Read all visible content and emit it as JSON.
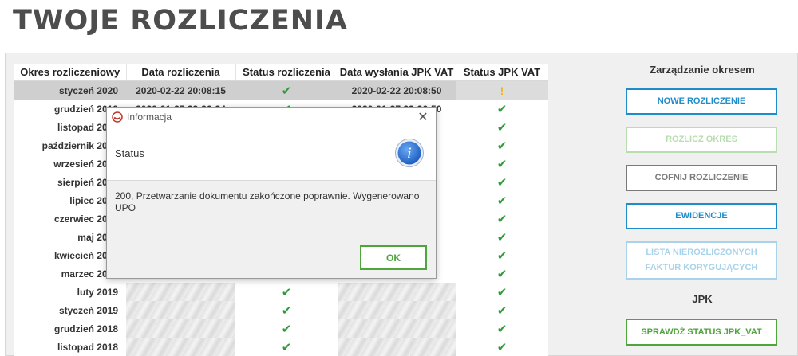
{
  "page": {
    "title": "TWOJE ROZLICZENIA"
  },
  "table": {
    "headers": [
      "Okres rozliczeniowy",
      "Data rozliczenia",
      "Status rozliczenia",
      "Data wysłania JPK VAT",
      "Status JPK VAT"
    ],
    "rows": [
      {
        "period": "styczeń 2020",
        "date": "2020-02-22 20:08:15",
        "sent": "2020-02-22 20:08:50",
        "jpk_status": "warning"
      },
      {
        "period": "grudzień 2019",
        "date": "2020-01-27 22:26:24",
        "sent": "2020-01-27 22:26:50",
        "jpk_status": "ok"
      },
      {
        "period": "listopad 2019",
        "date": "",
        "sent": "",
        "jpk_status": "ok"
      },
      {
        "period": "październik 2019",
        "date": "",
        "sent": "",
        "jpk_status": "ok"
      },
      {
        "period": "wrzesień 2019",
        "date": "",
        "sent": "",
        "jpk_status": "ok"
      },
      {
        "period": "sierpień 2019",
        "date": "",
        "sent": "",
        "jpk_status": "ok"
      },
      {
        "period": "lipiec 2019",
        "date": "",
        "sent": "",
        "jpk_status": "ok"
      },
      {
        "period": "czerwiec 2019",
        "date": "",
        "sent": "",
        "jpk_status": "ok"
      },
      {
        "period": "maj 2019",
        "date": "",
        "sent": "",
        "jpk_status": "ok"
      },
      {
        "period": "kwiecień 2019",
        "date": "",
        "sent": "",
        "jpk_status": "ok"
      },
      {
        "period": "marzec 2019",
        "date": "",
        "sent": "",
        "jpk_status": "ok"
      },
      {
        "period": "luty 2019",
        "date": "",
        "sent": "",
        "jpk_status": "ok"
      },
      {
        "period": "styczeń 2019",
        "date": "",
        "sent": "",
        "jpk_status": "ok"
      },
      {
        "period": "grudzień 2018",
        "date": "",
        "sent": "",
        "jpk_status": "ok"
      },
      {
        "period": "listopad 2018",
        "date": "",
        "sent": "",
        "jpk_status": "ok"
      }
    ],
    "icons": {
      "ok": "✔",
      "warning": "!"
    },
    "colors": {
      "ok": "#2e9a3a",
      "warning": "#f2b705"
    }
  },
  "sidebar": {
    "heading": "Zarządzanie okresem",
    "new_label": "NOWE ROZLICZENIE",
    "settle_label": "ROZLICZ OKRES",
    "undo_label": "COFNIJ ROZLICZENIE",
    "records_label": "EWIDENCJE",
    "list_label_line1": "LISTA NIEROZLICZONYCH",
    "list_label_line2": "FAKTUR KORYGUJĄCYCH",
    "jpk_heading": "JPK",
    "check_status_label": "SPRAWDŹ STATUS JPK_VAT"
  },
  "dialog": {
    "title": "Informacja",
    "close_glyph": "✕",
    "heading": "Status",
    "info_glyph": "i",
    "message": "200,  Przetwarzanie dokumentu zakończone poprawnie. Wygenerowano UPO",
    "ok_label": "OK"
  },
  "colors": {
    "accent_blue": "#1e8cc8",
    "accent_green": "#4fa43c",
    "title_gray": "#4d4d4d"
  }
}
